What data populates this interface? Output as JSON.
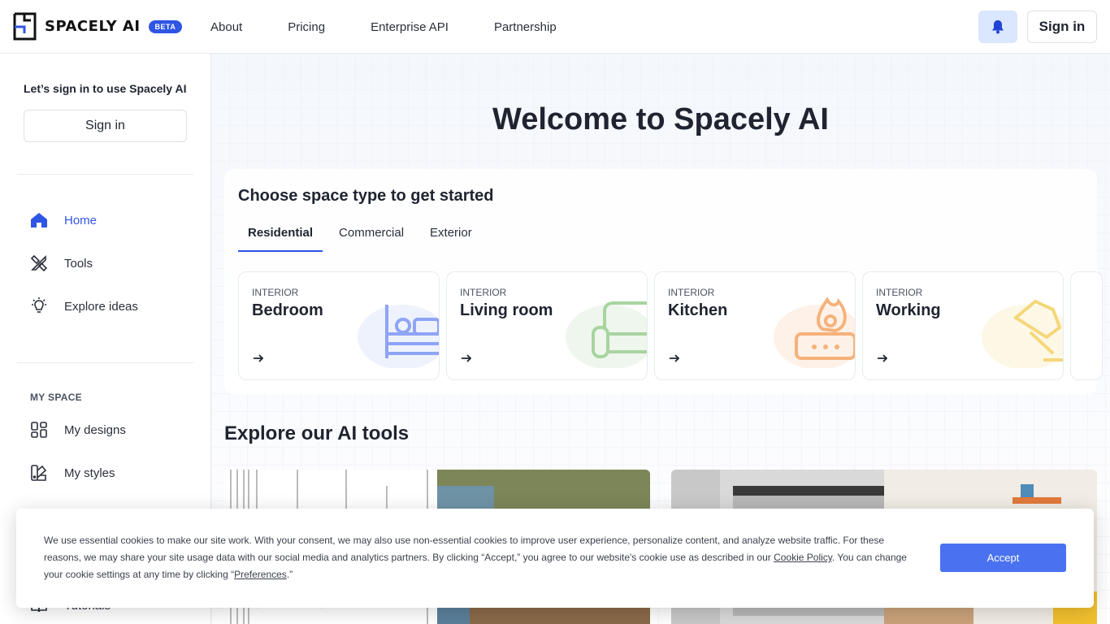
{
  "brand": {
    "name": "SPACELY AI",
    "badge": "BETA",
    "accent": "#2f55e4"
  },
  "nav": {
    "items": [
      {
        "label": "About"
      },
      {
        "label": "Pricing"
      },
      {
        "label": "Enterprise API"
      },
      {
        "label": "Partnership"
      }
    ],
    "bell_icon": "bell-icon",
    "signin_label": "Sign in"
  },
  "sidebar": {
    "prompt": "Let’s sign in to use Spacely AI",
    "signin_label": "Sign in",
    "items": [
      {
        "label": "Home",
        "icon": "home-icon",
        "active": true
      },
      {
        "label": "Tools",
        "icon": "tools-icon"
      },
      {
        "label": "Explore ideas",
        "icon": "lightbulb-icon"
      }
    ],
    "section_title": "MY SPACE",
    "space_items": [
      {
        "label": "My designs",
        "icon": "grid-icon"
      },
      {
        "label": "My styles",
        "icon": "palette-icon"
      },
      {
        "label": "Tutorials",
        "icon": "book-icon"
      }
    ]
  },
  "main": {
    "welcome": "Welcome to Spacely AI",
    "space_title": "Choose space type to get started",
    "tabs": [
      {
        "label": "Residential",
        "active": true
      },
      {
        "label": "Commercial"
      },
      {
        "label": "Exterior"
      }
    ],
    "space_types": [
      {
        "category": "INTERIOR",
        "name": "Bedroom",
        "icon": "bed-icon",
        "color": "#8ea4f5",
        "bg": "#eef2fd"
      },
      {
        "category": "INTERIOR",
        "name": "Living room",
        "icon": "sofa-icon",
        "color": "#a8d4a0",
        "bg": "#eef6ed"
      },
      {
        "category": "INTERIOR",
        "name": "Kitchen",
        "icon": "stove-icon",
        "color": "#f5b27a",
        "bg": "#fdf1e8"
      },
      {
        "category": "INTERIOR",
        "name": "Working",
        "icon": "lamp-icon",
        "color": "#f5d77a",
        "bg": "#fdf8e6"
      }
    ],
    "tools_title": "Explore our AI tools"
  },
  "cookie": {
    "text_1": "We use essential cookies to make our site work. With your consent, we may also use non-essential cookies to improve user experience, personalize content, and analyze website traffic. For these reasons, we may share your site usage data with our social media and analytics partners. By clicking “Accept,” you agree to our website's cookie use as described in our ",
    "policy_link": "Cookie Policy",
    "text_2": ". You can change your cookie settings at any time by clicking “",
    "preferences_link": "Preferences",
    "text_3": ".”",
    "accept_label": "Accept"
  }
}
